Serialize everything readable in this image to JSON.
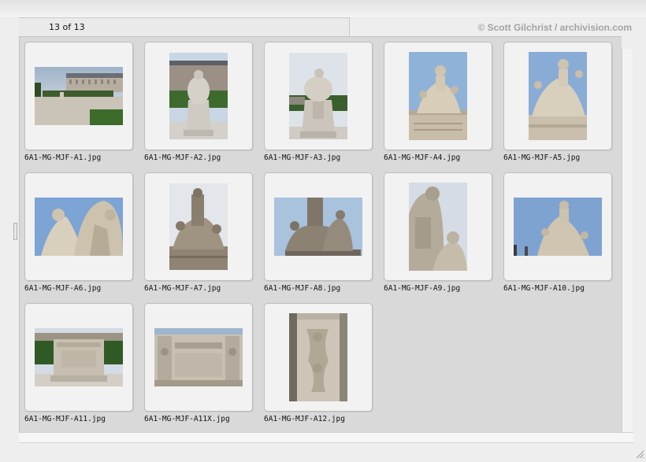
{
  "header": {
    "counter": "13 of 13",
    "copyright": "© Scott Gilchrist / archivision.com"
  },
  "gallery": {
    "items": [
      {
        "file_name": "6A1-MG-MJF-A1.jpg"
      },
      {
        "file_name": "6A1-MG-MJF-A2.jpg"
      },
      {
        "file_name": "6A1-MG-MJF-A3.jpg"
      },
      {
        "file_name": "6A1-MG-MJF-A4.jpg"
      },
      {
        "file_name": "6A1-MG-MJF-A5.jpg"
      },
      {
        "file_name": "6A1-MG-MJF-A6.jpg"
      },
      {
        "file_name": "6A1-MG-MJF-A7.jpg"
      },
      {
        "file_name": "6A1-MG-MJF-A8.jpg"
      },
      {
        "file_name": "6A1-MG-MJF-A9.jpg"
      },
      {
        "file_name": "6A1-MG-MJF-A10.jpg"
      },
      {
        "file_name": "6A1-MG-MJF-A11.jpg"
      },
      {
        "file_name": "6A1-MG-MJF-A11X.jpg"
      },
      {
        "file_name": "6A1-MG-MJF-A12.jpg"
      }
    ]
  },
  "colors": {
    "panel": "#d9d9d9",
    "thumb_frame": "#f2f2f2",
    "copyright": "#a3a3a3"
  }
}
